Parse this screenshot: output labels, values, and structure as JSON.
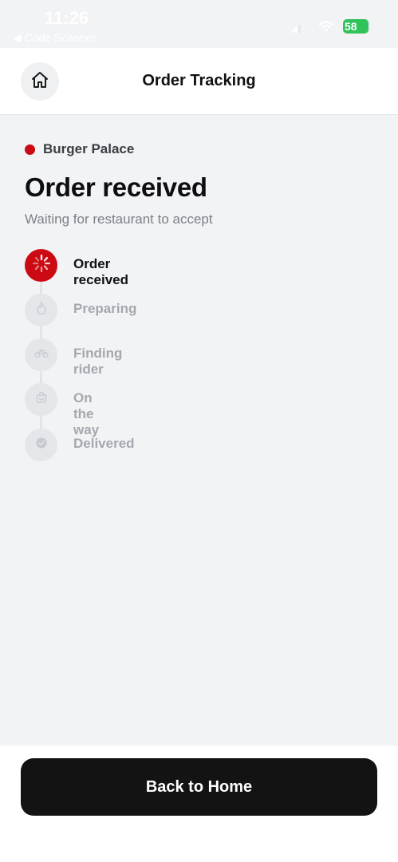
{
  "status_bar": {
    "time": "11:26",
    "back_app": "◀ Code Scanner",
    "battery": "58"
  },
  "header": {
    "title": "Order Tracking",
    "home_icon": "home-icon"
  },
  "order": {
    "restaurant": "Burger Palace",
    "status_heading": "Order received",
    "status_subtitle": "Waiting for restaurant to accept"
  },
  "steps": [
    {
      "label": "Order received",
      "icon": "spinner-icon",
      "state": "active"
    },
    {
      "label": "Preparing",
      "icon": "flame-icon",
      "state": "pending"
    },
    {
      "label": "Finding rider",
      "icon": "bike-icon",
      "state": "pending"
    },
    {
      "label": "On the way",
      "icon": "bag-icon",
      "state": "pending"
    },
    {
      "label": "Delivered",
      "icon": "check-circle-icon",
      "state": "pending"
    }
  ],
  "footer": {
    "back_home_label": "Back to Home"
  },
  "colors": {
    "accent": "#cc0a14",
    "background": "#f2f3f5",
    "button": "#131314",
    "battery": "#2fc35a"
  }
}
